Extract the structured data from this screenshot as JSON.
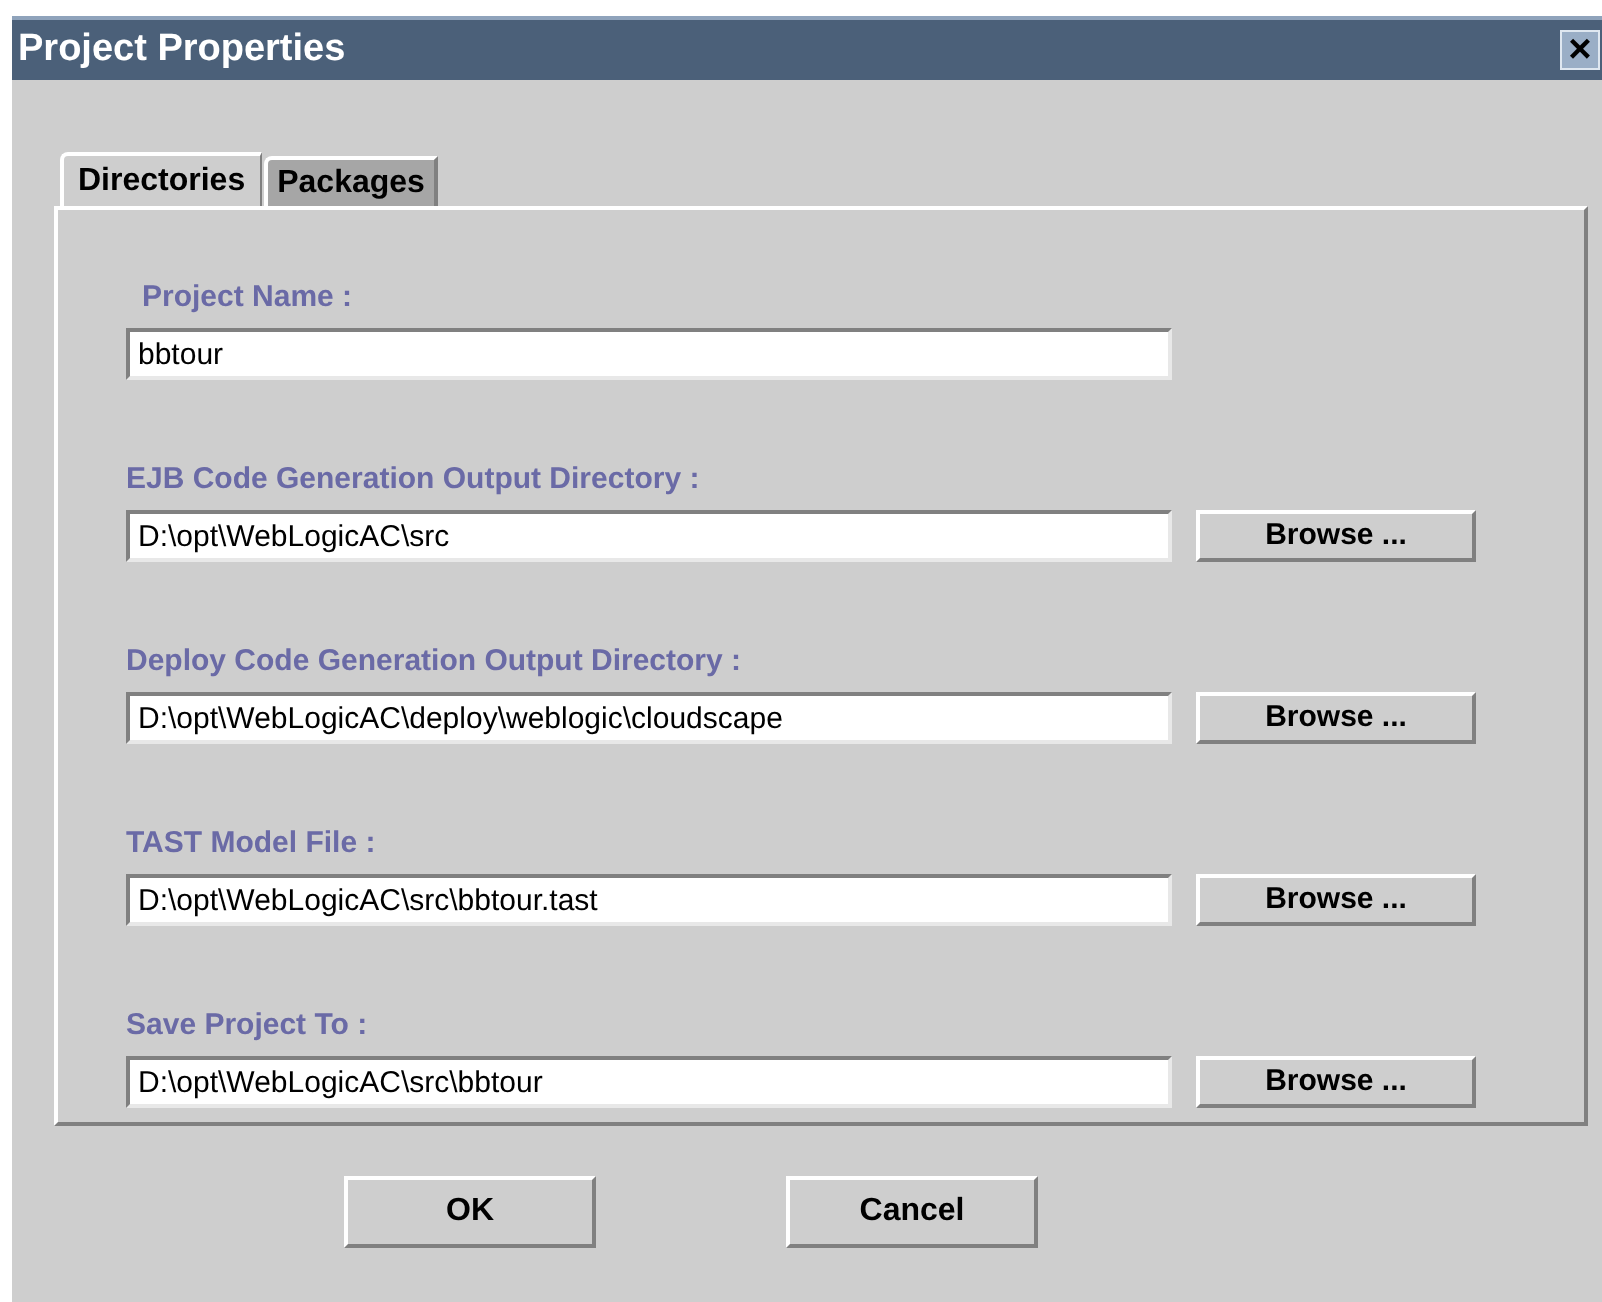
{
  "window": {
    "title": "Project Properties",
    "close": "×"
  },
  "tabs": [
    {
      "label": "Directories",
      "selected": true
    },
    {
      "label": "Packages",
      "selected": false
    }
  ],
  "fields": [
    {
      "kind": "text",
      "label": "Project Name :",
      "value": "bbtour"
    },
    {
      "kind": "browse",
      "label": "EJB Code Generation Output Directory :",
      "value": "D:\\opt\\WebLogicAC\\src",
      "button": "Browse ..."
    },
    {
      "kind": "browse",
      "label": "Deploy Code Generation Output Directory :",
      "value": "D:\\opt\\WebLogicAC\\deploy\\weblogic\\cloudscape",
      "button": "Browse ..."
    },
    {
      "kind": "browse",
      "label": "TAST Model File :",
      "value": "D:\\opt\\WebLogicAC\\src\\bbtour.tast",
      "button": "Browse ..."
    },
    {
      "kind": "browse",
      "label": "Save Project To :",
      "value": "D:\\opt\\WebLogicAC\\src\\bbtour",
      "button": "Browse ..."
    }
  ],
  "buttons": [
    "OK",
    "Cancel"
  ]
}
